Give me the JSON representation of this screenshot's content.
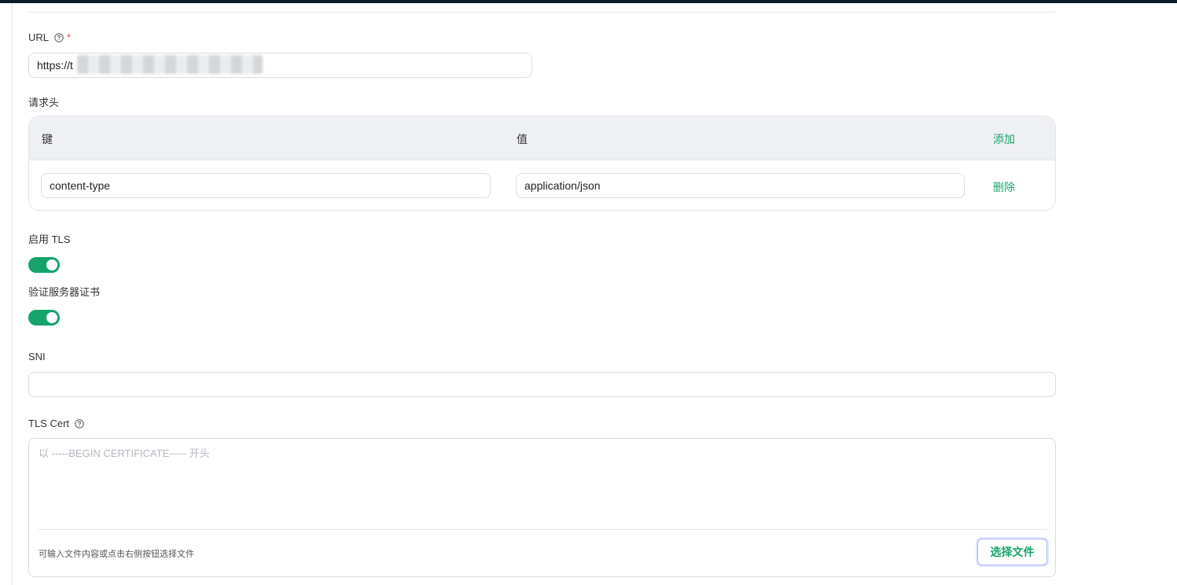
{
  "url": {
    "label": "URL",
    "required_mark": "*",
    "value": "https://t"
  },
  "headers": {
    "label": "请求头",
    "key_column": "键",
    "value_column": "值",
    "add_label": "添加",
    "rows": [
      {
        "key": "content-type",
        "value": "application/json",
        "delete_label": "删除"
      }
    ]
  },
  "tls": {
    "label": "启用 TLS",
    "enabled": true
  },
  "verify_cert": {
    "label": "验证服务器证书",
    "enabled": true
  },
  "sni": {
    "label": "SNI",
    "value": ""
  },
  "tls_cert": {
    "label": "TLS Cert",
    "placeholder": "以 -----BEGIN CERTIFICATE----- 开头",
    "hint": "可输入文件内容或点击右侧按钮选择文件",
    "choose_file_label": "选择文件"
  },
  "icons": {
    "help": "question-circle-icon"
  },
  "colors": {
    "accent": "#16a36b",
    "required": "#e5483f",
    "header_bg": "#eef0f4"
  }
}
